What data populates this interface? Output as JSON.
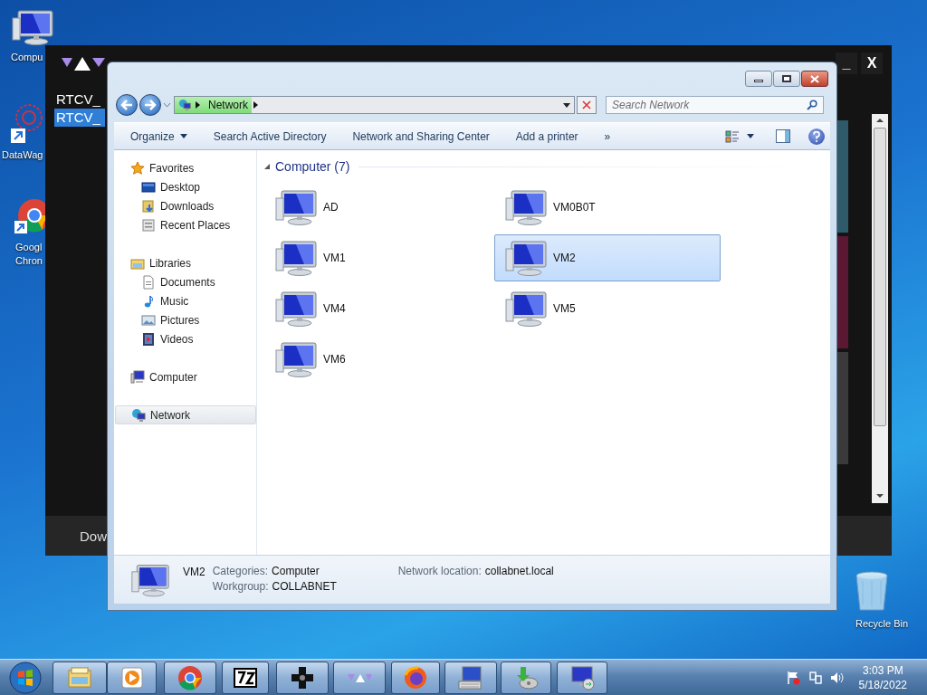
{
  "desktop_icons": [
    {
      "kind": "computer",
      "lines": [
        "Compu"
      ]
    },
    {
      "kind": "network-app",
      "lines": [
        "DataWag"
      ]
    },
    {
      "kind": "chrome",
      "lines": [
        "Googl",
        "Chron"
      ]
    },
    {
      "kind": "recycle",
      "lines": [
        "Recycle Bin"
      ]
    }
  ],
  "background_window": {
    "list": [
      {
        "label": "RTCV_",
        "selected": false
      },
      {
        "label": "RTCV_",
        "selected": true
      }
    ],
    "footer": "Dow",
    "buttons": [
      "_",
      "X"
    ]
  },
  "explorer": {
    "address": {
      "crumb": "Network"
    },
    "search": {
      "placeholder": "Search Network"
    },
    "toolbar": [
      {
        "label": "Organize",
        "dropdown": true
      },
      {
        "label": "Search Active Directory",
        "dropdown": false
      },
      {
        "label": "Network and Sharing Center",
        "dropdown": false
      },
      {
        "label": "Add a printer",
        "dropdown": false
      },
      {
        "label": "»",
        "dropdown": false
      }
    ],
    "nav": [
      {
        "label": "Favorites",
        "kind": "star",
        "selected": false,
        "children": [
          {
            "label": "Desktop",
            "kind": "desktop",
            "selected": false
          },
          {
            "label": "Downloads",
            "kind": "downloads",
            "selected": false
          },
          {
            "label": "Recent Places",
            "kind": "recent",
            "selected": false
          }
        ]
      },
      {
        "label": "Libraries",
        "kind": "library",
        "selected": false,
        "children": [
          {
            "label": "Documents",
            "kind": "document",
            "selected": false
          },
          {
            "label": "Music",
            "kind": "music",
            "selected": false
          },
          {
            "label": "Pictures",
            "kind": "pictures",
            "selected": false
          },
          {
            "label": "Videos",
            "kind": "videos",
            "selected": false
          }
        ]
      },
      {
        "label": "Computer",
        "kind": "computer",
        "selected": false
      },
      {
        "label": "Network",
        "kind": "network",
        "selected": true
      }
    ],
    "group": {
      "title": "Computer (7)"
    },
    "items": [
      {
        "label": "AD",
        "selected": false
      },
      {
        "label": "VM0B0T",
        "selected": false
      },
      {
        "label": "VM1",
        "selected": false
      },
      {
        "label": "VM2",
        "selected": true
      },
      {
        "label": "VM4",
        "selected": false
      },
      {
        "label": "VM5",
        "selected": false
      },
      {
        "label": "VM6",
        "selected": false
      }
    ],
    "details": {
      "name": "VM2",
      "fields": [
        {
          "label": "Categories:",
          "value": "Computer"
        },
        {
          "label": "Network location:",
          "value": "collabnet.local"
        },
        {
          "label": "Workgroup:",
          "value": "COLLABNET"
        }
      ]
    }
  },
  "taskbar": {
    "items": [
      {
        "kind": "explorer"
      },
      {
        "kind": "media"
      },
      {
        "kind": "chrome"
      },
      {
        "kind": "sevenzip"
      },
      {
        "kind": "gamepad"
      },
      {
        "kind": "launcher"
      },
      {
        "kind": "firefox"
      },
      {
        "kind": "keyboard-pc"
      },
      {
        "kind": "installer"
      },
      {
        "kind": "remote"
      }
    ],
    "time": "3:03 PM",
    "date": "5/18/2022"
  }
}
